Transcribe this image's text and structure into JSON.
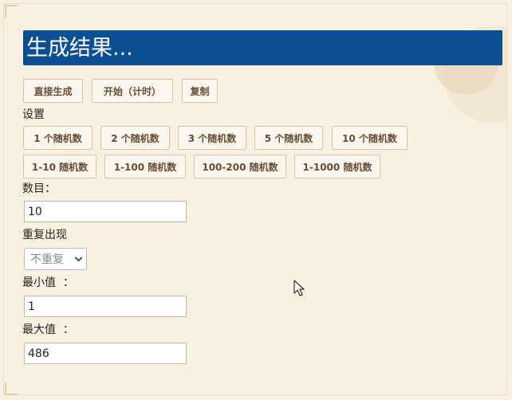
{
  "result": {
    "title": "生成结果..."
  },
  "actions": [
    {
      "label": "直接生成"
    },
    {
      "label": "开始（计时）"
    },
    {
      "label": "复制"
    }
  ],
  "settings": {
    "heading": "设置",
    "presets_row1": [
      {
        "label": "1 个随机数"
      },
      {
        "label": "2 个随机数"
      },
      {
        "label": "3 个随机数"
      },
      {
        "label": "5 个随机数"
      },
      {
        "label": "10 个随机数"
      }
    ],
    "presets_row2": [
      {
        "label": "1-10 随机数"
      },
      {
        "label": "1-100 随机数"
      },
      {
        "label": "100-200 随机数"
      },
      {
        "label": "1-1000 随机数"
      }
    ],
    "count": {
      "label": "数目：",
      "value": "10"
    },
    "repeat": {
      "label": "重复出现",
      "selected": "不重复"
    },
    "min": {
      "label": "最小值  ：",
      "value": "1"
    },
    "max": {
      "label": "最大值  ：",
      "value": "486"
    }
  },
  "colors": {
    "background": "#f8f0e0",
    "banner": "#0d4f93",
    "button_text": "#6a4b34"
  }
}
